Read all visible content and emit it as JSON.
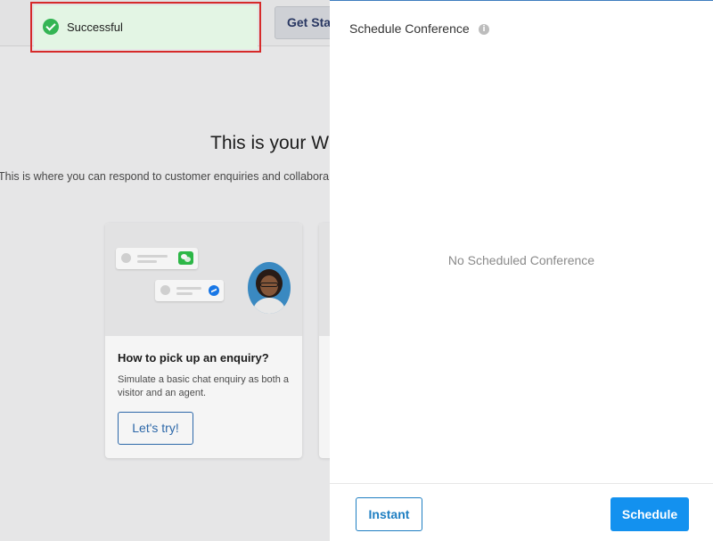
{
  "toast": {
    "message": "Successful",
    "icon": "check-circle-icon",
    "status_color": "#34b554",
    "background": "#e3f5e4"
  },
  "background_page": {
    "header_button_label": "Get Sta",
    "title": "This is your W",
    "subtitle": "This is where you can respond to customer enquiries and collabora",
    "card": {
      "title": "How to pick up an enquiry?",
      "description": "Simulate a basic chat enquiry as both a visitor and an agent.",
      "button_label": "Let's try!",
      "icons": [
        "wechat-icon",
        "messenger-icon"
      ]
    }
  },
  "panel": {
    "title": "Schedule Conference",
    "info_icon": "info-icon",
    "empty_message": "No Scheduled Conference",
    "instant_button_label": "Instant",
    "schedule_button_label": "Schedule",
    "accent_color": "#1391ef"
  }
}
